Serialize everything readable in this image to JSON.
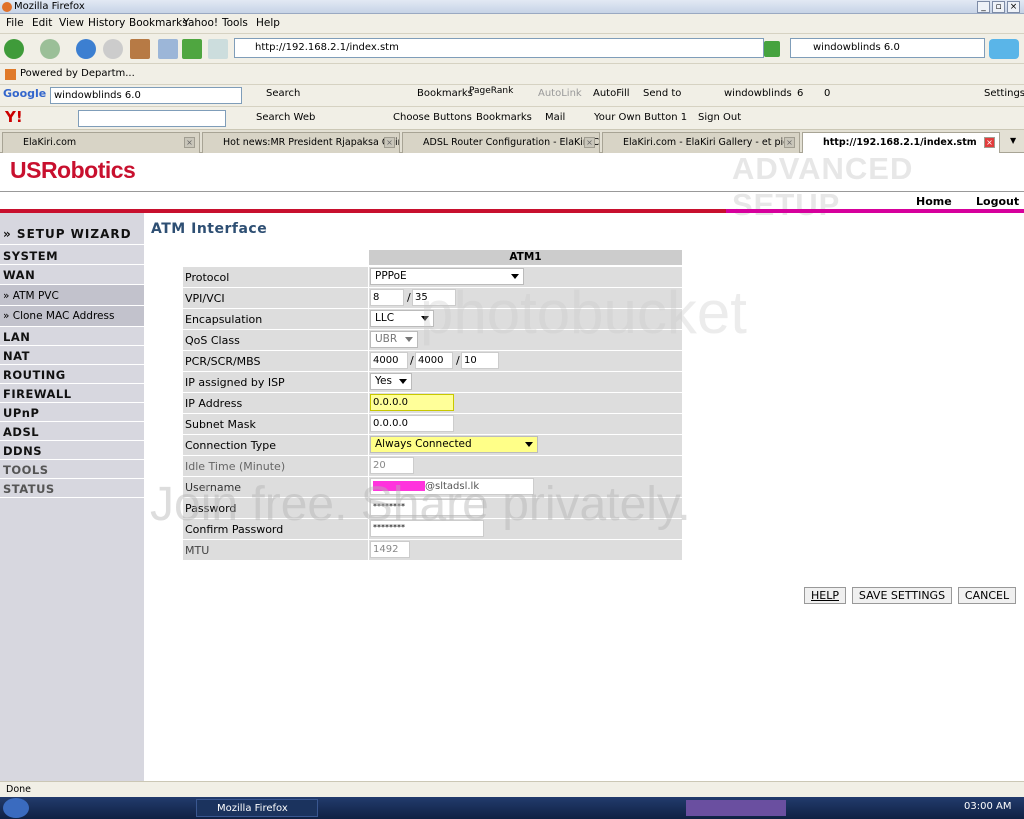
{
  "window": {
    "title": "Mozilla Firefox"
  },
  "menu": [
    "File",
    "Edit",
    "View",
    "History",
    "Bookmarks",
    "Yahoo!",
    "Tools",
    "Help"
  ],
  "navbar": {
    "url": "http://192.168.2.1/index.stm",
    "search": "windowblinds 6.0"
  },
  "bookmarks_bar": {
    "item": "Powered by Departm..."
  },
  "google_toolbar": {
    "brand": "Google",
    "query": "windowblinds 6.0",
    "search": "Search",
    "bookmarks": "Bookmarks",
    "pagerank": "PageRank",
    "autolink": "AutoLink",
    "autofill": "AutoFill",
    "sendto": "Send to",
    "term": "windowblinds",
    "count1": "6",
    "count2": "0",
    "settings": "Settings"
  },
  "yahoo_toolbar": {
    "searchweb": "Search Web",
    "choose": "Choose Buttons",
    "bookmarks": "Bookmarks",
    "mail": "Mail",
    "own": "Your Own Button 1",
    "signout": "Sign Out"
  },
  "tabs": [
    {
      "label": "ElaKiri.com"
    },
    {
      "label": "Hot news:MR President Rjapaksa Goin..."
    },
    {
      "label": "ADSL Router Configuration - ElaKiri Co..."
    },
    {
      "label": "ElaKiri.com - ElaKiri Gallery - et pics"
    },
    {
      "label": "http://192.168.2.1/index.stm"
    }
  ],
  "header": {
    "brand": "USRobotics",
    "section": "ADVANCED SETUP",
    "home": "Home",
    "logout": "Logout"
  },
  "sidebar": {
    "wizard": "» SETUP WIZARD",
    "items": [
      "SYSTEM",
      "WAN",
      "» ATM PVC",
      "» Clone MAC Address",
      "LAN",
      "NAT",
      "ROUTING",
      "FIREWALL",
      "UPnP",
      "ADSL",
      "DDNS",
      "TOOLS",
      "STATUS"
    ]
  },
  "main": {
    "title": "ATM Interface",
    "column": "ATM1",
    "labels": {
      "protocol": "Protocol",
      "vpivci": "VPI/VCI",
      "encap": "Encapsulation",
      "qos": "QoS Class",
      "pcr": "PCR/SCR/MBS",
      "ipisp": "IP assigned by ISP",
      "ip": "IP Address",
      "mask": "Subnet Mask",
      "conn": "Connection Type",
      "idle": "Idle Time (Minute)",
      "user": "Username",
      "pass": "Password",
      "cpass": "Confirm Password",
      "mtu": "MTU"
    },
    "values": {
      "protocol": "PPPoE",
      "vpi": "8",
      "vci": "35",
      "encap": "LLC",
      "qos": "UBR",
      "pcr": "4000",
      "scr": "4000",
      "mbs": "10",
      "ipisp": "Yes",
      "ip": "0.0.0.0",
      "mask": "0.0.0.0",
      "conn": "Always Connected",
      "idle": "20",
      "user_suffix": "@sltadsl.lk",
      "pass": "********",
      "cpass": "********",
      "mtu": "1492"
    },
    "slash": "/",
    "buttons": {
      "help": "HELP",
      "save": "SAVE SETTINGS",
      "cancel": "CANCEL"
    }
  },
  "watermark": {
    "top": "photobucket",
    "bottom": "Join free. Share privately."
  },
  "status": {
    "text": "Done"
  },
  "taskbar": {
    "task": "Mozilla Firefox",
    "clock": "03:00 AM"
  }
}
